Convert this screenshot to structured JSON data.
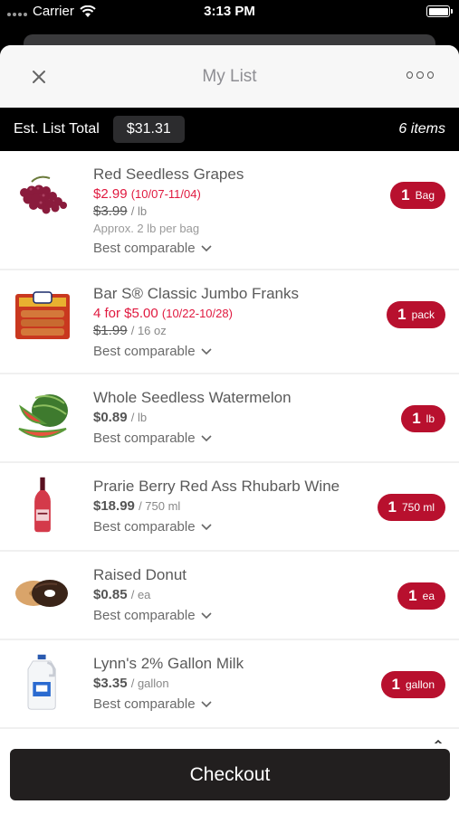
{
  "status_bar": {
    "carrier": "Carrier",
    "time": "3:13 PM"
  },
  "nav": {
    "title": "My List"
  },
  "total_bar": {
    "label": "Est. List Total",
    "value": "$31.31",
    "count": "6 items"
  },
  "items": [
    {
      "name": "Red Seedless Grapes",
      "sale_price": "$2.99",
      "sale_dates": "(10/07-11/04)",
      "orig_price": "$3.99",
      "orig_unit": "/ lb",
      "note": "Approx. 2 lb per bag",
      "comparable": "Best comparable",
      "qty": "1",
      "qty_unit": "Bag",
      "image": "grapes-image"
    },
    {
      "name": "Bar S® Classic Jumbo Franks",
      "sale_price": "4 for $5.00",
      "sale_dates": "(10/22-10/28)",
      "orig_price": "$1.99",
      "orig_unit": "/ 16 oz",
      "comparable": "Best comparable",
      "qty": "1",
      "qty_unit": "pack",
      "image": "franks-package-image"
    },
    {
      "name": "Whole Seedless Watermelon",
      "price": "$0.89",
      "price_unit": "/ lb",
      "comparable": "Best comparable",
      "qty": "1",
      "qty_unit": "lb",
      "image": "watermelon-image"
    },
    {
      "name": "Prarie Berry Red Ass Rhubarb Wine",
      "price": "$18.99",
      "price_unit": "/ 750 ml",
      "comparable": "Best comparable",
      "qty": "1",
      "qty_unit": "750 ml",
      "image": "wine-bottle-image"
    },
    {
      "name": "Raised Donut",
      "price": "$0.85",
      "price_unit": "/ ea",
      "comparable": "Best comparable",
      "qty": "1",
      "qty_unit": "ea",
      "image": "donut-image"
    },
    {
      "name": "Lynn's 2% Gallon Milk",
      "price": "$3.35",
      "price_unit": "/ gallon",
      "comparable": "Best comparable",
      "qty": "1",
      "qty_unit": "gallon",
      "image": "milk-jug-image"
    }
  ],
  "checkout": {
    "label": "Checkout"
  },
  "colors": {
    "accent": "#b8102e",
    "sale_text": "#e0193f",
    "checkout_bg": "#221f1f"
  }
}
